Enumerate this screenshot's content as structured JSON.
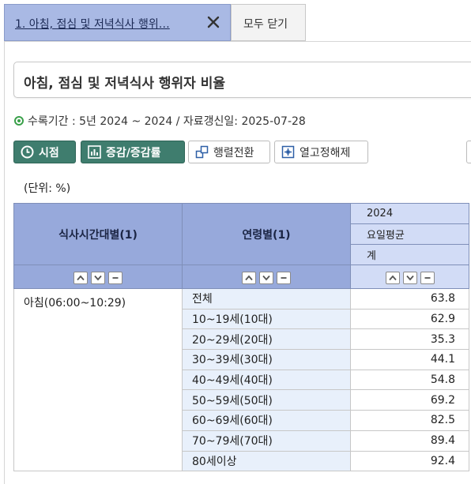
{
  "tabs": {
    "active_label": "1. 아침, 점심 및 저녁식사 행위…",
    "close_all_label": "모두 닫기"
  },
  "table_title": "아침, 점심 및 저녁식사 행위자 비율",
  "period_text": "수록기간 : 5년 2024 ~ 2024 / 자료갱신일: 2025-07-28",
  "toolbar": {
    "timepoint_label": "시점",
    "change_label": "증감/증감률",
    "pivot_label": "행렬전환",
    "unfreeze_label": "열고정해제"
  },
  "unit_label": "(단위: %)",
  "table": {
    "header_time": "식사시간대별(1)",
    "header_age": "연령별(1)",
    "header_year": "2024",
    "header_dayavg": "요일평균",
    "header_total": "계",
    "time_group": "아침(06:00~10:29)",
    "rows": [
      {
        "age": "전체",
        "value": "63.8"
      },
      {
        "age": "10~19세(10대)",
        "value": "62.9"
      },
      {
        "age": "20~29세(20대)",
        "value": "35.3"
      },
      {
        "age": "30~39세(30대)",
        "value": "44.1"
      },
      {
        "age": "40~49세(40대)",
        "value": "54.8"
      },
      {
        "age": "50~59세(50대)",
        "value": "69.2"
      },
      {
        "age": "60~69세(60대)",
        "value": "82.5"
      },
      {
        "age": "70~79세(70대)",
        "value": "89.4"
      },
      {
        "age": "80세이상",
        "value": "92.4"
      }
    ]
  },
  "colors": {
    "tab_active": "#a9b9e4",
    "button_green": "#3f7d6e",
    "header": "#97a9db",
    "header_light": "#d2dcf6",
    "age_cell": "#e8f0fb"
  },
  "icons": [
    "close-icon",
    "clock-icon",
    "bar-chart-icon",
    "pivot-icon",
    "unfreeze-icon",
    "sort-up-icon",
    "sort-down-icon",
    "collapse-icon"
  ]
}
